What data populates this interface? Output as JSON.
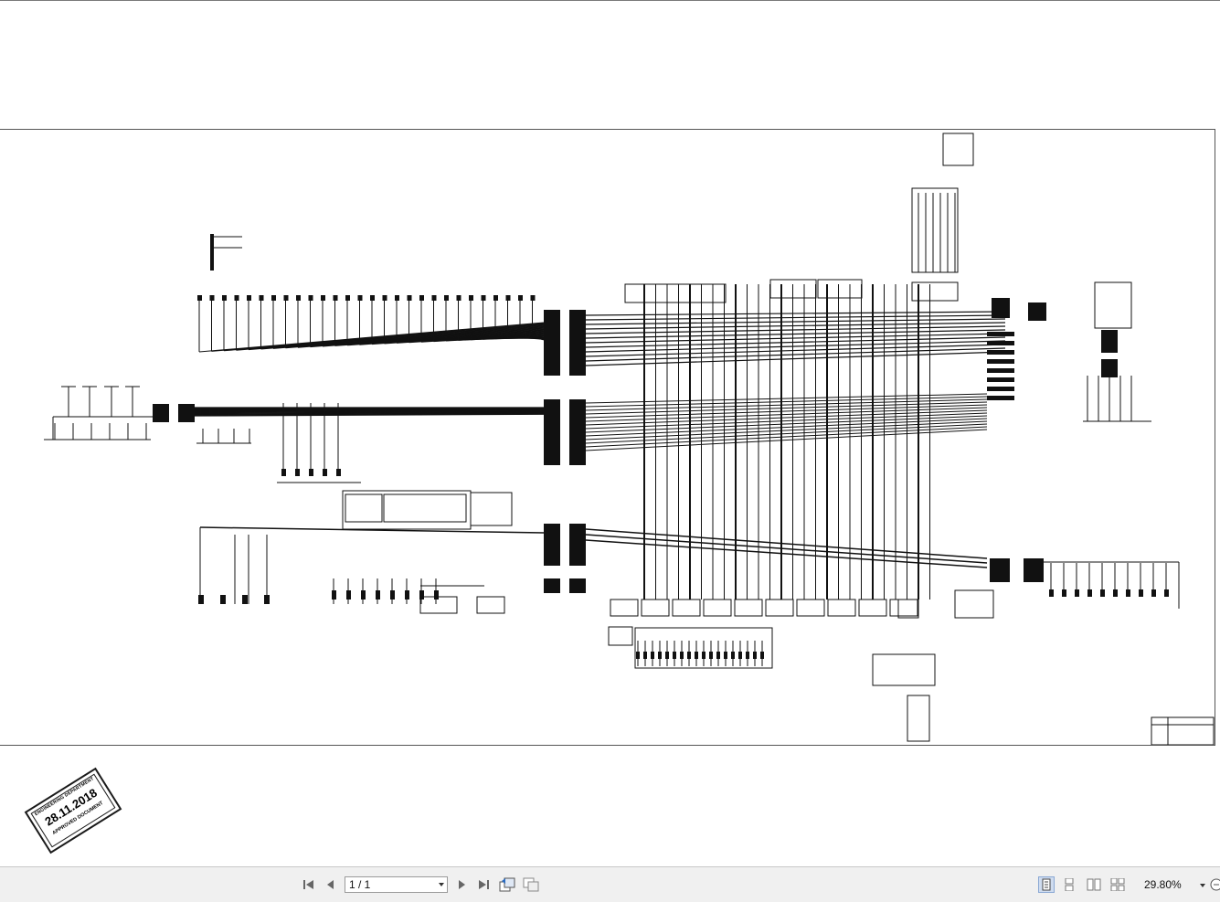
{
  "stamp": {
    "department": "ENGINEERING DEPARTMENT",
    "date": "28.11.2018",
    "status": "APPROVED DOCUMENT"
  },
  "toolbar": {
    "first_page_icon": "first-page-icon",
    "prev_page_icon": "previous-page-icon",
    "page_indicator": "1 / 1",
    "next_page_icon": "next-page-icon",
    "last_page_icon": "last-page-icon",
    "zoom_level": "29.80%"
  }
}
